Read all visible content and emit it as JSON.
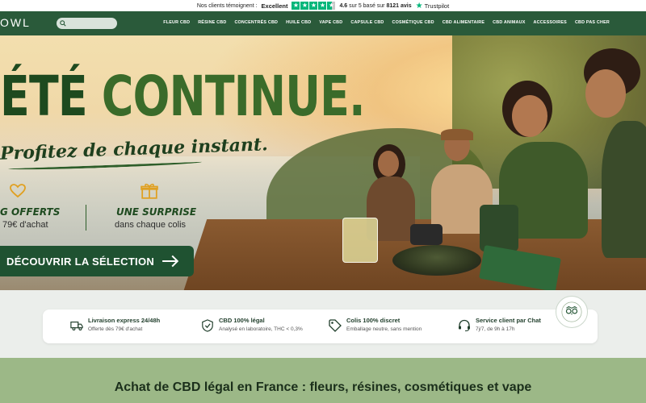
{
  "trustbar": {
    "prefix": "Nos clients témoignent :",
    "rating_word": "Excellent",
    "score": "4.6",
    "score_suffix": "sur 5 basé sur",
    "reviews": "8121 avis",
    "provider": "Trustpilot",
    "star_icon": "star-icon",
    "star_color": "#00b67a"
  },
  "nav": {
    "brand": "OWL",
    "search_placeholder": "",
    "items": [
      "FLEUR CBD",
      "RÉSINE CBD",
      "CONCENTRÉS CBD",
      "HUILE CBD",
      "VAPE CBD",
      "CAPSULE CBD",
      "COSMÉTIQUE CBD",
      "CBD ALIMENTAIRE",
      "CBD ANIMAUX",
      "ACCESSOIRES",
      "CBD PAS CHER"
    ],
    "background": "#2a5a3a"
  },
  "hero": {
    "headline_part1": "ÉTÉ",
    "headline_part2": "CONTINUE.",
    "subline": "Profitez de chaque instant.",
    "perk1_title": "G OFFERTS",
    "perk1_sub": "79€ d'achat",
    "perk1_icon": "heart-icon",
    "perk2_title": "UNE SURPRISE",
    "perk2_sub": "dans chaque colis",
    "perk2_icon": "gift-icon",
    "cta_label": "DÉCOUVRIR LA SÉLECTION",
    "cta_icon": "arrow-right-icon",
    "accent": "#1f5231"
  },
  "reassurance": [
    {
      "title": "Livraison express 24/48h",
      "sub": "Offerte dès 79€ d'achat",
      "icon": "truck-icon"
    },
    {
      "title": "CBD 100% légal",
      "sub": "Analysé en laboratoire, THC < 0,3%",
      "icon": "shield-check-icon"
    },
    {
      "title": "Colis 100% discret",
      "sub": "Emballage neutre, sans mention",
      "icon": "tag-icon"
    },
    {
      "title": "Service client par Chat",
      "sub": "7j/7, de 9h à 17h",
      "icon": "headset-icon"
    }
  ],
  "badge": {
    "icon": "owl-badge-icon"
  },
  "section": {
    "title": "Achat de CBD légal en France : fleurs, résines, cosmétiques et vape"
  }
}
